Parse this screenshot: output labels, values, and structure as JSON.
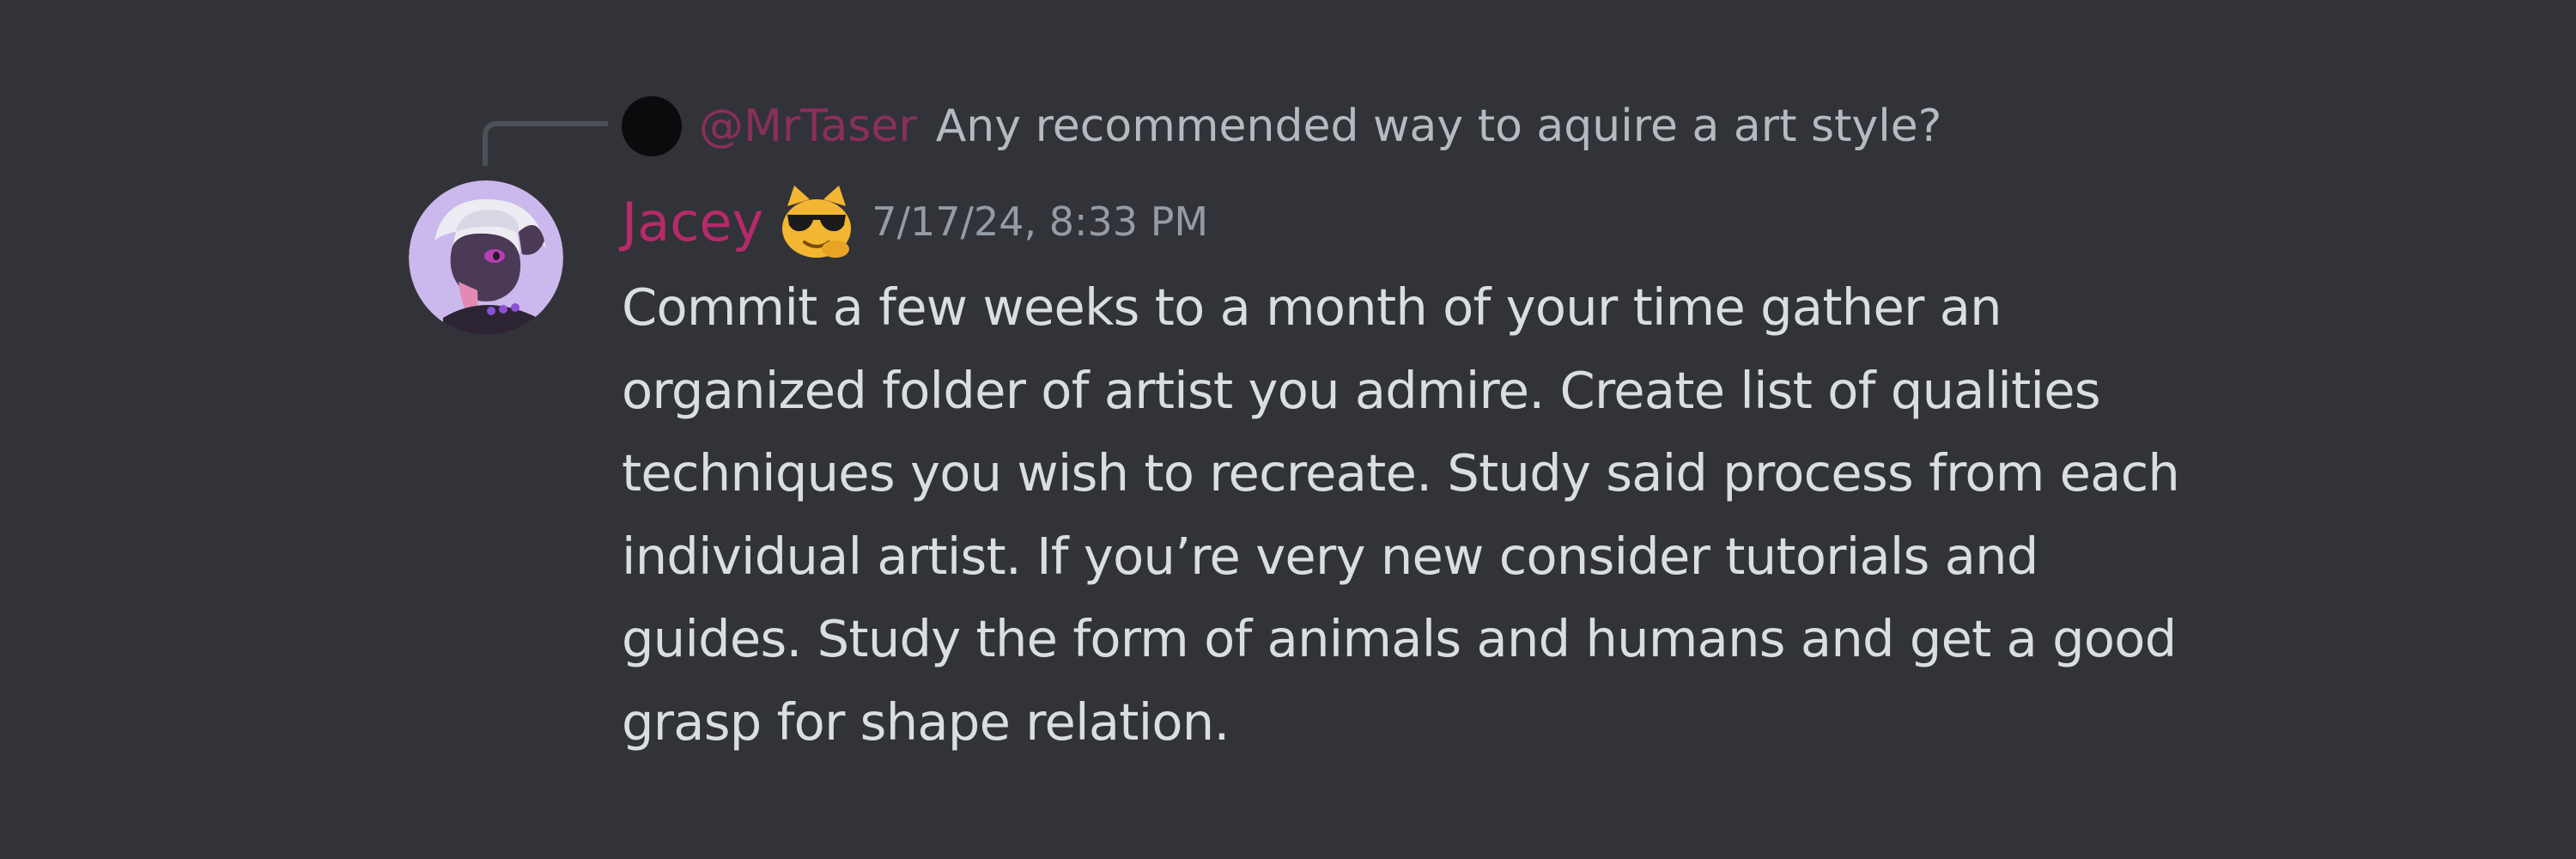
{
  "reply": {
    "author": "@MrTaser",
    "text": "Any recommended way to aquire a art style?"
  },
  "message": {
    "username": "Jacey",
    "timestamp": "7/17/24, 8:33 PM",
    "role_icon": "cool-sunglasses-emoji-icon",
    "lines": [
      "Commit a few weeks to a month of your time gather an",
      "organized folder of artist you admire. Create list of qualities",
      "techniques you wish to recreate. Study said process from each",
      "individual artist. If you’re very new consider tutorials and",
      "guides. Study the form of animals and humans and get a good",
      "grasp for shape relation."
    ]
  },
  "colors": {
    "background": "#313338",
    "username": "#b52a6a",
    "reply_author": "#8a2f5a",
    "text": "#dbdee1",
    "muted": "#949ba4"
  }
}
